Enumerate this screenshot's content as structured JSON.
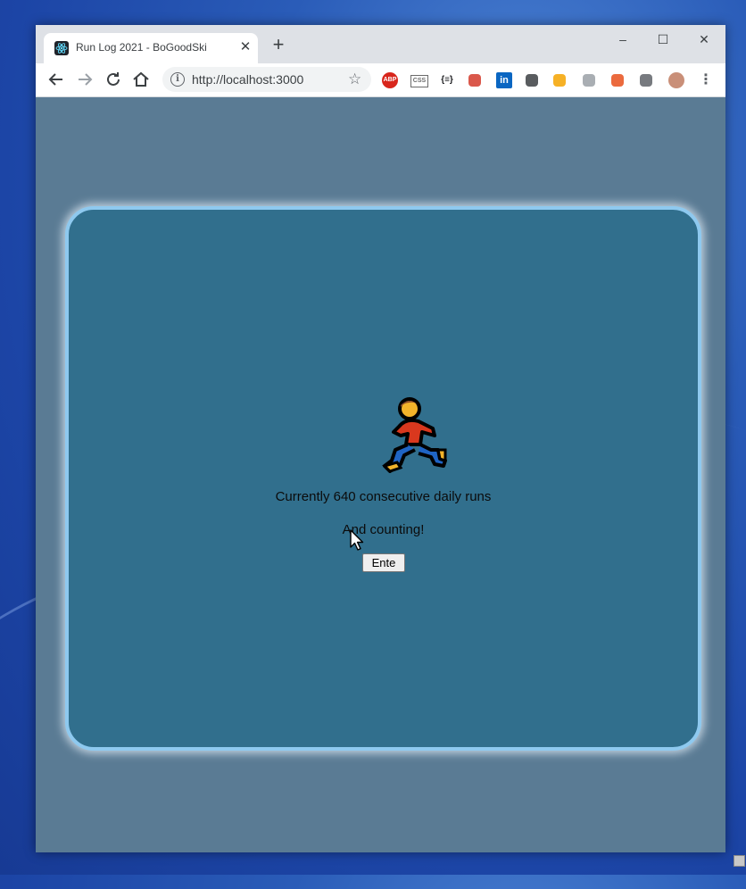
{
  "browser": {
    "tab_title": "Run Log 2021 - BoGoodSki",
    "tab_close": "✕",
    "new_tab": "+",
    "url": "http://localhost:3000",
    "window_controls": {
      "minimize": "–",
      "maximize": "☐",
      "close": "✕"
    },
    "extensions": [
      {
        "name": "adblock-plus-icon",
        "label": "ABP",
        "color": "#d8261c"
      },
      {
        "name": "css-viewer-icon",
        "label": "CSS",
        "color": "#6b6b6b"
      },
      {
        "name": "json-formatter-icon",
        "label": "{≡}",
        "color": "#202124"
      },
      {
        "name": "red-extension-icon",
        "label": "",
        "color": "#d33b2c"
      },
      {
        "name": "linkedin-icon",
        "label": "in",
        "color": "#0a66c2"
      },
      {
        "name": "dark-mode-icon",
        "label": "",
        "color": "#3c4043"
      },
      {
        "name": "arc-extension-icon",
        "label": "",
        "color": "#f4a300"
      },
      {
        "name": "timer-extension-icon",
        "label": "",
        "color": "#9aa0a6"
      },
      {
        "name": "fire-extension-icon",
        "label": "",
        "color": "#e8501c"
      },
      {
        "name": "puzzle-extensions-icon",
        "label": "",
        "color": "#5f6368"
      },
      {
        "name": "profile-avatar",
        "label": "",
        "color": "#c98f78"
      },
      {
        "name": "kebab-menu-icon",
        "label": "⋮",
        "color": "#5f6368"
      }
    ]
  },
  "app": {
    "runs_text": "Currently 640 consecutive daily runs",
    "counting_text": "And counting!",
    "enter_button": "Ente",
    "icon": "person-running-icon"
  },
  "colors": {
    "page_background": "#5a7b94",
    "card_background": "#316f8d",
    "card_border": "#8ec9ef"
  }
}
